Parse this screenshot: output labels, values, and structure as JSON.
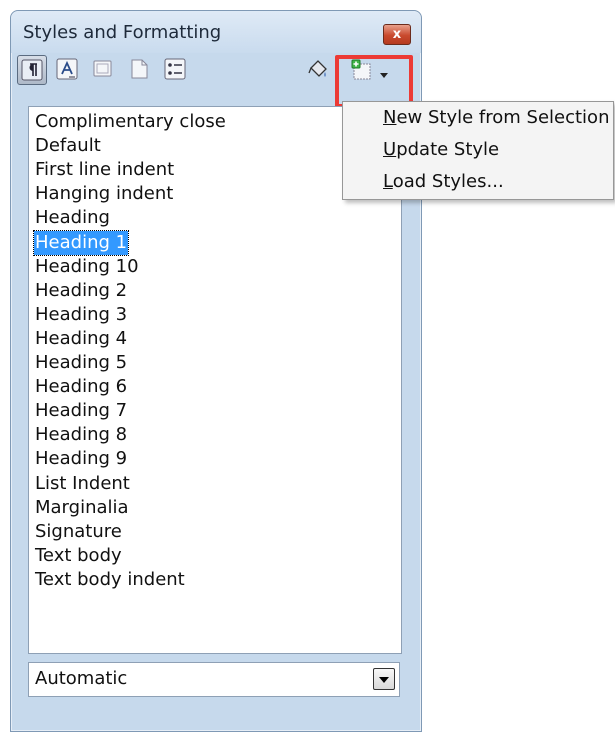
{
  "window": {
    "title": "Styles and Formatting",
    "close_glyph": "x"
  },
  "toolbar": {
    "buttons": [
      {
        "name": "paragraph-styles",
        "icon": "paragraph-styles-icon",
        "pressed": true
      },
      {
        "name": "character-styles",
        "icon": "character-styles-icon",
        "pressed": false
      },
      {
        "name": "frame-styles",
        "icon": "frame-styles-icon",
        "pressed": false
      },
      {
        "name": "page-styles",
        "icon": "page-styles-icon",
        "pressed": false
      },
      {
        "name": "list-styles",
        "icon": "list-styles-icon",
        "pressed": false
      },
      {
        "name": "fill-format-mode",
        "icon": "paint-bucket-icon",
        "pressed": false
      },
      {
        "name": "new-style-menu",
        "icon": "new-style-icon",
        "pressed": false
      }
    ]
  },
  "styles_list": {
    "items": [
      "Complimentary close",
      "Default",
      "First line indent",
      "Hanging indent",
      "Heading",
      "Heading 1",
      "Heading 10",
      "Heading 2",
      "Heading 3",
      "Heading 4",
      "Heading 5",
      "Heading 6",
      "Heading 7",
      "Heading 8",
      "Heading 9",
      "List Indent",
      "Marginalia",
      "Signature",
      "Text body",
      "Text body indent"
    ],
    "selected_index": 5
  },
  "filter_select": {
    "value": "Automatic"
  },
  "context_menu": {
    "items": [
      {
        "accel": "N",
        "rest": "ew Style from Selection"
      },
      {
        "accel": "U",
        "rest": "pdate Style"
      },
      {
        "accel": "L",
        "rest": "oad Styles..."
      }
    ]
  },
  "colors": {
    "selection": "#3399ff",
    "highlight_box": "#ec3a35",
    "window_frame": "#c6d9ec"
  }
}
